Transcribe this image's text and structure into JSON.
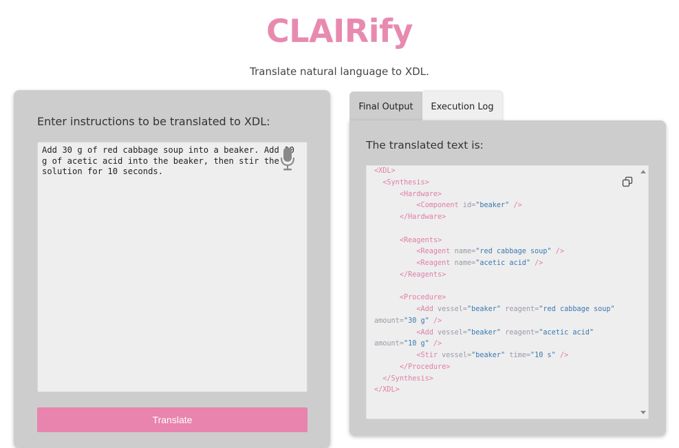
{
  "app": {
    "title": "CLAIRify",
    "subtitle": "Translate natural language to XDL."
  },
  "input_panel": {
    "label": "Enter instructions to be translated to XDL:",
    "instructions_value": "Add 30 g of red cabbage soup into a beaker. Add 10 g of acetic acid into the beaker, then stir the solution for 10 seconds.",
    "mic_icon": "microphone-icon",
    "translate_label": "Translate"
  },
  "output_panel": {
    "tabs": [
      {
        "label": "Final Output"
      },
      {
        "label": "Execution Log"
      }
    ],
    "label": "The translated text is:",
    "copy_icon": "copy-icon",
    "code_lines": [
      "<XDL>",
      "  <Synthesis>",
      "      <Hardware>",
      "          <Component id=\"beaker\" />",
      "      </Hardware>",
      "",
      "      <Reagents>",
      "          <Reagent name=\"red cabbage soup\" />",
      "          <Reagent name=\"acetic acid\" />",
      "      </Reagents>",
      "",
      "      <Procedure>",
      "          <Add vessel=\"beaker\" reagent=\"red cabbage soup\" amount=\"30 g\" />",
      "          <Add vessel=\"beaker\" reagent=\"acetic acid\" amount=\"10 g\" />",
      "          <Stir vessel=\"beaker\" time=\"10 s\" />",
      "      </Procedure>",
      "  </Synthesis>",
      "</XDL>"
    ]
  },
  "colors": {
    "brand": "#e88ab0",
    "button": "#e884ad",
    "panel": "#cdcdcd",
    "field": "#eeeeee",
    "xml_tag": "#e07da8",
    "xml_attr": "#9a9aa8",
    "xml_value": "#3a78b0"
  }
}
